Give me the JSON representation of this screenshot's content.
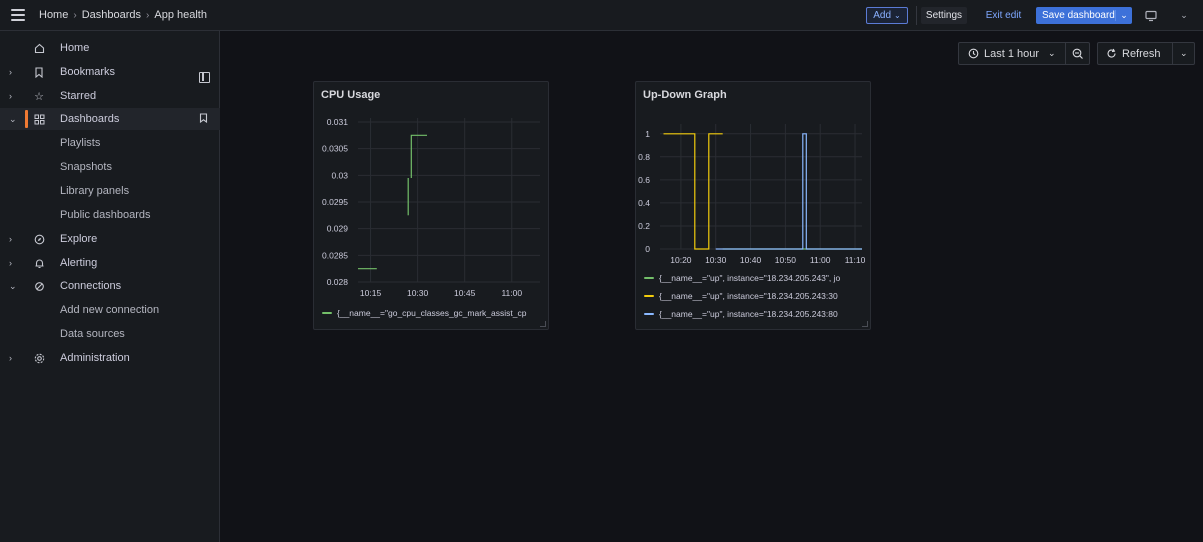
{
  "breadcrumb": {
    "items": [
      "Home",
      "Dashboards",
      "App health"
    ],
    "separator": "›"
  },
  "toolbar": {
    "add_label": "Add",
    "settings_label": "Settings",
    "exit_edit_label": "Exit edit",
    "save_label": "Save dashboard",
    "accent_color": "#3d71d9"
  },
  "sidebar": {
    "items": [
      {
        "label": "Home",
        "icon": "home-icon"
      },
      {
        "label": "Bookmarks",
        "icon": "bookmark-icon"
      },
      {
        "label": "Starred",
        "icon": "star-icon"
      },
      {
        "label": "Dashboards",
        "icon": "apps-icon"
      },
      {
        "label": "Playlists"
      },
      {
        "label": "Snapshots"
      },
      {
        "label": "Library panels"
      },
      {
        "label": "Public dashboards"
      },
      {
        "label": "Explore",
        "icon": "compass-icon"
      },
      {
        "label": "Alerting",
        "icon": "bell-icon"
      },
      {
        "label": "Connections",
        "icon": "link-icon"
      },
      {
        "label": "Add new connection"
      },
      {
        "label": "Data sources"
      },
      {
        "label": "Administration",
        "icon": "cog-icon"
      }
    ],
    "active_color": "#f07a33"
  },
  "controls": {
    "time_range_label": "Last 1 hour",
    "refresh_label": "Refresh"
  },
  "panels": [
    {
      "title": "CPU Usage",
      "legend": [
        {
          "label": "{__name__=\"go_cpu_classes_gc_mark_assist_cp",
          "color": "#73bf69"
        }
      ]
    },
    {
      "title": "Up-Down Graph",
      "legend": [
        {
          "label": "{__name__=\"up\", instance=\"18.234.205.243\", jo",
          "color": "#73bf69"
        },
        {
          "label": "{__name__=\"up\", instance=\"18.234.205.243:30",
          "color": "#f2cc0c"
        },
        {
          "label": "{__name__=\"up\", instance=\"18.234.205.243:80",
          "color": "#8ab8ff"
        }
      ]
    }
  ],
  "chart_data": [
    {
      "type": "line",
      "title": "CPU Usage",
      "x_ticks": [
        "10:15",
        "10:30",
        "10:45",
        "11:00"
      ],
      "y_ticks": [
        0.028,
        0.0285,
        0.029,
        0.0295,
        0.03,
        0.0305,
        0.031
      ],
      "ylim": [
        0.028,
        0.031
      ],
      "xlim_minutes": [
        "10:11",
        "11:09"
      ],
      "grid": true,
      "legend_placement": "bottom",
      "series": [
        {
          "name": "{__name__=\"go_cpu_classes_gc_mark_assist_cp",
          "color": "#73bf69",
          "segments": [
            [
              [
                "10:11",
                0.02825
              ],
              [
                "10:17",
                0.02825
              ]
            ],
            [
              [
                "10:27",
                0.02925
              ],
              [
                "10:27",
                0.02995
              ]
            ],
            [
              [
                "10:28",
                0.02995
              ],
              [
                "10:28",
                0.03075
              ],
              [
                "10:33",
                0.03075
              ]
            ]
          ]
        }
      ]
    },
    {
      "type": "line",
      "title": "Up-Down Graph",
      "x_ticks": [
        "10:20",
        "10:30",
        "10:40",
        "10:50",
        "11:00",
        "11:10"
      ],
      "y_ticks": [
        0,
        0.2,
        0.4,
        0.6,
        0.8,
        1
      ],
      "ylim": [
        0,
        1.05
      ],
      "xlim_minutes": [
        "10:14",
        "11:12"
      ],
      "grid": true,
      "legend_placement": "bottom",
      "series": [
        {
          "name": "{__name__=\"up\", instance=\"18.234.205.243\", jo",
          "color": "#73bf69",
          "points": [
            [
              "10:32",
              0
            ],
            [
              "11:12",
              0
            ]
          ]
        },
        {
          "name": "{__name__=\"up\", instance=\"18.234.205.243:30",
          "color": "#f2cc0c",
          "points": [
            [
              "10:15",
              1
            ],
            [
              "10:24",
              1
            ],
            [
              "10:24",
              0
            ],
            [
              "10:28",
              0
            ],
            [
              "10:28",
              1
            ],
            [
              "10:32",
              1
            ]
          ]
        },
        {
          "name": "{__name__=\"up\", instance=\"18.234.205.243:80",
          "color": "#8ab8ff",
          "points": [
            [
              "10:30",
              0
            ],
            [
              "10:55",
              0
            ],
            [
              "10:55",
              1
            ],
            [
              "10:56",
              1
            ],
            [
              "10:56",
              0
            ],
            [
              "11:12",
              0
            ]
          ]
        }
      ]
    }
  ]
}
